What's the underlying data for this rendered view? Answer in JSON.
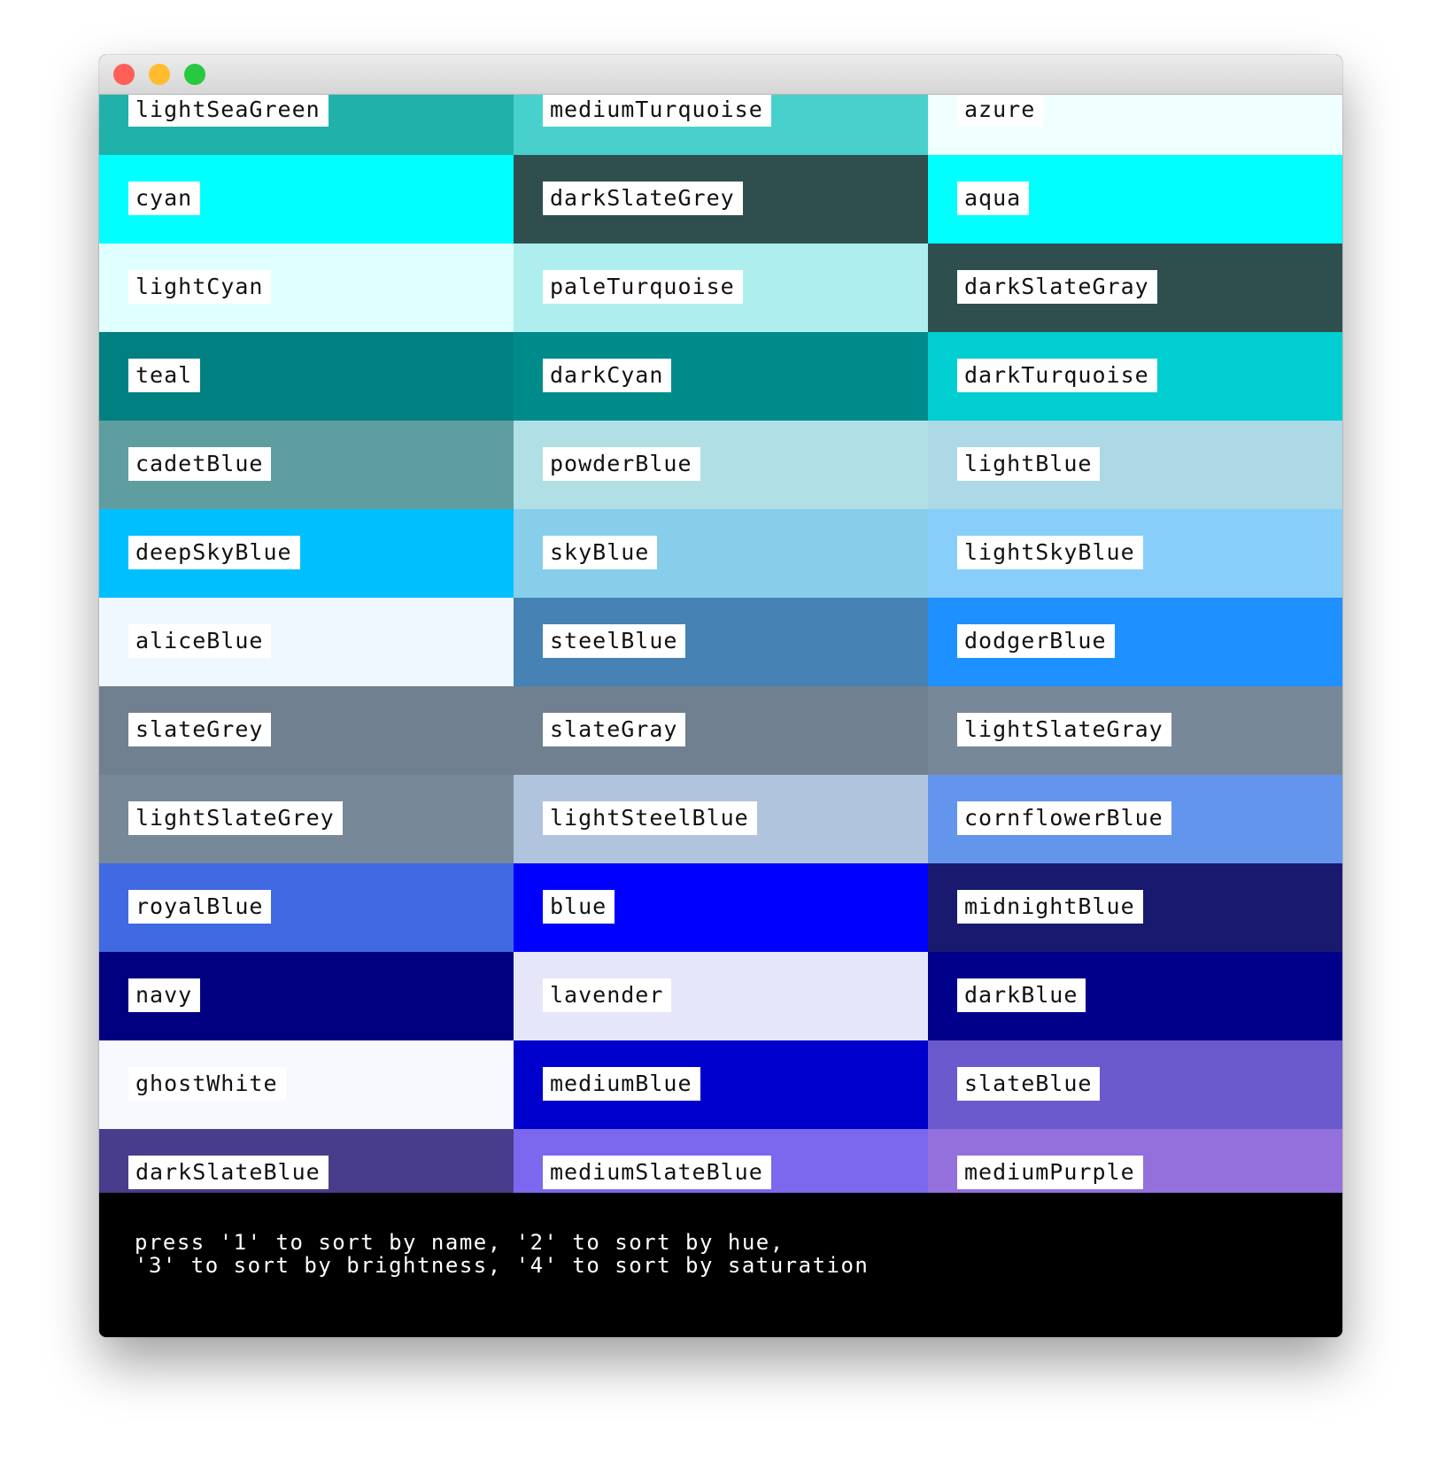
{
  "window": {
    "controls": {
      "close": "#ff5f57",
      "minimize": "#febc2e",
      "zoom": "#28c840"
    }
  },
  "grid": {
    "rows": [
      [
        {
          "name": "lightSeaGreen",
          "color": "#20b2aa"
        },
        {
          "name": "mediumTurquoise",
          "color": "#48d1cc"
        },
        {
          "name": "azure",
          "color": "#f0ffff"
        }
      ],
      [
        {
          "name": "cyan",
          "color": "#00ffff"
        },
        {
          "name": "darkSlateGrey",
          "color": "#2f4f4f"
        },
        {
          "name": "aqua",
          "color": "#00ffff"
        }
      ],
      [
        {
          "name": "lightCyan",
          "color": "#e0ffff"
        },
        {
          "name": "paleTurquoise",
          "color": "#afeeee"
        },
        {
          "name": "darkSlateGray",
          "color": "#2f4f4f"
        }
      ],
      [
        {
          "name": "teal",
          "color": "#008080"
        },
        {
          "name": "darkCyan",
          "color": "#008b8b"
        },
        {
          "name": "darkTurquoise",
          "color": "#00ced1"
        }
      ],
      [
        {
          "name": "cadetBlue",
          "color": "#5f9ea0"
        },
        {
          "name": "powderBlue",
          "color": "#b0e0e6"
        },
        {
          "name": "lightBlue",
          "color": "#add8e6"
        }
      ],
      [
        {
          "name": "deepSkyBlue",
          "color": "#00bfff"
        },
        {
          "name": "skyBlue",
          "color": "#87ceeb"
        },
        {
          "name": "lightSkyBlue",
          "color": "#87cefa"
        }
      ],
      [
        {
          "name": "aliceBlue",
          "color": "#f0f8ff"
        },
        {
          "name": "steelBlue",
          "color": "#4682b4"
        },
        {
          "name": "dodgerBlue",
          "color": "#1e90ff"
        }
      ],
      [
        {
          "name": "slateGrey",
          "color": "#708090"
        },
        {
          "name": "slateGray",
          "color": "#708090"
        },
        {
          "name": "lightSlateGray",
          "color": "#778899"
        }
      ],
      [
        {
          "name": "lightSlateGrey",
          "color": "#778899"
        },
        {
          "name": "lightSteelBlue",
          "color": "#b0c4de"
        },
        {
          "name": "cornflowerBlue",
          "color": "#6495ed"
        }
      ],
      [
        {
          "name": "royalBlue",
          "color": "#4169e1"
        },
        {
          "name": "blue",
          "color": "#0000ff"
        },
        {
          "name": "midnightBlue",
          "color": "#191970"
        }
      ],
      [
        {
          "name": "navy",
          "color": "#000080"
        },
        {
          "name": "lavender",
          "color": "#e6e6fa"
        },
        {
          "name": "darkBlue",
          "color": "#00008b"
        }
      ],
      [
        {
          "name": "ghostWhite",
          "color": "#f8f8ff"
        },
        {
          "name": "mediumBlue",
          "color": "#0000cd"
        },
        {
          "name": "slateBlue",
          "color": "#6a5acd"
        }
      ],
      [
        {
          "name": "darkSlateBlue",
          "color": "#483d8b"
        },
        {
          "name": "mediumSlateBlue",
          "color": "#7b68ee"
        },
        {
          "name": "mediumPurple",
          "color": "#9370db"
        }
      ]
    ],
    "partial_row_colors": [
      "#8a2be2",
      "#4b0082",
      "#9932cc"
    ]
  },
  "footer": {
    "line1": "press '1' to sort by name, '2' to sort by hue,",
    "line2": "'3' to sort by brightness, '4' to sort by saturation"
  }
}
